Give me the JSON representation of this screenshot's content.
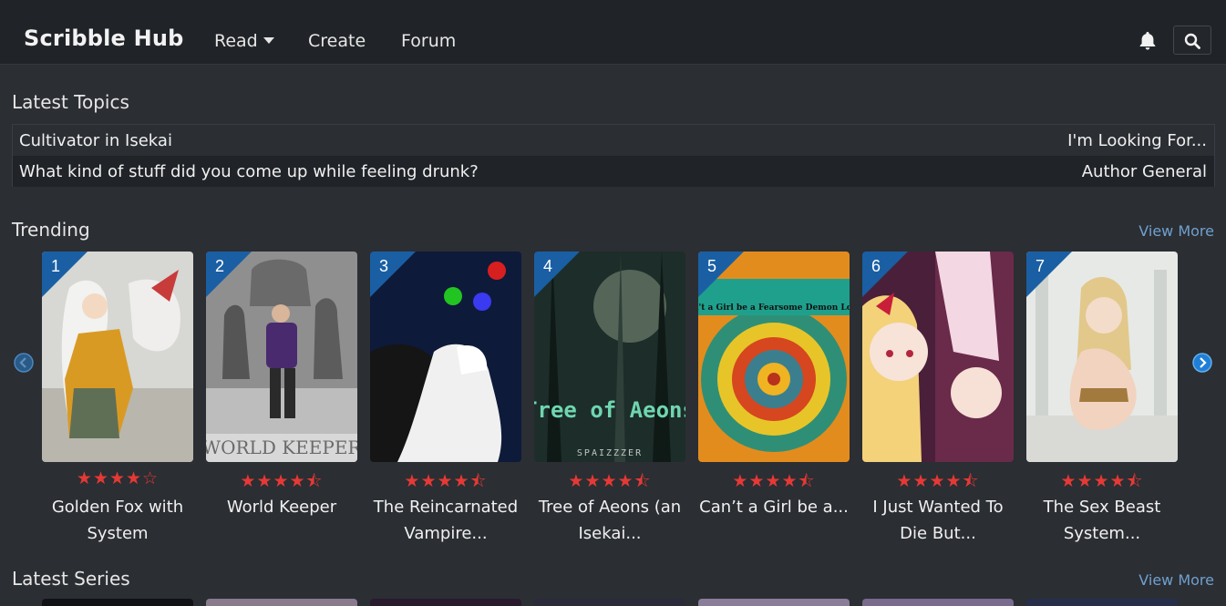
{
  "header": {
    "brand": "Scribble Hub",
    "nav": {
      "read": "Read",
      "create": "Create",
      "forum": "Forum"
    },
    "icons": {
      "notifications": "bell-icon",
      "search": "search-icon"
    }
  },
  "latest_topics": {
    "title": "Latest Topics",
    "rows": [
      {
        "title": "Cultivator in Isekai",
        "category": "I'm Looking For..."
      },
      {
        "title": "What kind of stuff did you come up while feeling drunk?",
        "category": "Author General"
      }
    ]
  },
  "trending": {
    "title": "Trending",
    "view_more": "View More",
    "items": [
      {
        "rank": "1",
        "stars": "★★★★☆",
        "rating": 4.0,
        "title": "Golden Fox with System",
        "cover": "fox-spirit-artwork"
      },
      {
        "rank": "2",
        "stars": "★★★★⯪",
        "rating": 4.5,
        "title": "World Keeper",
        "cover": "world-keeper-artwork"
      },
      {
        "rank": "3",
        "stars": "★★★★⯪",
        "rating": 4.5,
        "title": "The Reincarnated Vampire...",
        "cover": "vampire-artwork"
      },
      {
        "rank": "4",
        "stars": "★★★★⯪",
        "rating": 4.5,
        "title": "Tree of Aeons (an Isekai...",
        "cover": "tree-of-aeons-artwork",
        "cover_text": "Tree of Aeons",
        "cover_subtext": "SPAIZZZER"
      },
      {
        "rank": "5",
        "stars": "★★★★⯪",
        "rating": 4.5,
        "title": "Can’t a Girl be a...",
        "cover": "swirl-artwork",
        "cover_text": "Can't a Girl be a Fearsome Demon Lord?"
      },
      {
        "rank": "6",
        "stars": "★★★★⯪",
        "rating": 4.5,
        "title": "I Just Wanted To Die But...",
        "cover": "anime-girls-artwork"
      },
      {
        "rank": "7",
        "stars": "★★★★⯪",
        "rating": 4.5,
        "title": "The Sex Beast System...",
        "cover": "elf-girl-artwork"
      }
    ]
  },
  "latest_series": {
    "title": "Latest Series",
    "view_more": "View More"
  },
  "colors": {
    "navbar": "#202327",
    "background": "#2b2e33",
    "accent_link": "#6fa0cf",
    "rank_badge": "#1a5fa3",
    "stars": "#e53935"
  }
}
